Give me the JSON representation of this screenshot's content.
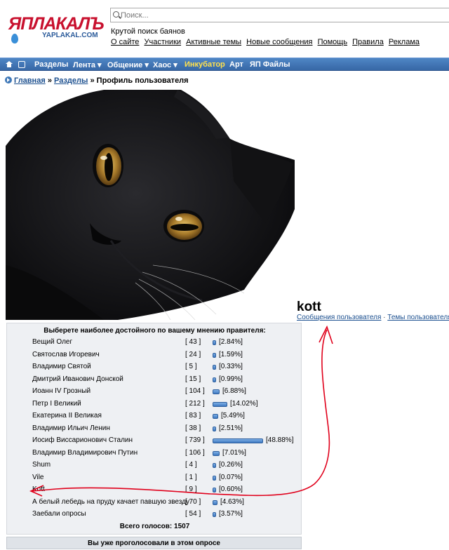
{
  "header": {
    "logo_text": "ЯПЛАКАЛЪ",
    "logo_sub": "YAPLAKAL.COM",
    "search_placeholder": "Поиск...",
    "tagline": "Крутой поиск баянов",
    "links": [
      "О сайте",
      "Участники",
      "Активные темы",
      "Новые сообщения",
      "Помощь",
      "Правила",
      "Реклама"
    ]
  },
  "nav": {
    "items": [
      "Разделы",
      "Лента ▾",
      "Общение ▾",
      "Хаос ▾",
      "Инкубатор",
      "Арт",
      "ЯП Файлы"
    ]
  },
  "breadcrumb": {
    "home": "Главная",
    "section": "Разделы",
    "sep": "»",
    "current": "Профиль пользователя"
  },
  "profile": {
    "username": "kott",
    "posts_link": "Сообщения пользователя",
    "link_sep": "·",
    "topics_link": "Темы пользователя"
  },
  "poll": {
    "title": "Выберете наиболее достойного по вашему мнению правителя:",
    "options": [
      {
        "name": "Вещий Олег",
        "count": "[ 43 ]",
        "percent": "[2.84%]",
        "value": 2.84
      },
      {
        "name": "Святослав Игоревич",
        "count": "[ 24 ]",
        "percent": "[1.59%]",
        "value": 1.59
      },
      {
        "name": "Владимир Святой",
        "count": "[ 5 ]",
        "percent": "[0.33%]",
        "value": 0.33
      },
      {
        "name": "Дмитрий Иванович Донской",
        "count": "[ 15 ]",
        "percent": "[0.99%]",
        "value": 0.99
      },
      {
        "name": "Иоанн IV Грозный",
        "count": "[ 104 ]",
        "percent": "[6.88%]",
        "value": 6.88
      },
      {
        "name": "Петр I Великий",
        "count": "[ 212 ]",
        "percent": "[14.02%]",
        "value": 14.02
      },
      {
        "name": "Екатерина II Великая",
        "count": "[ 83 ]",
        "percent": "[5.49%]",
        "value": 5.49
      },
      {
        "name": "Владимир Ильич Ленин",
        "count": "[ 38 ]",
        "percent": "[2.51%]",
        "value": 2.51
      },
      {
        "name": "Иосиф Виссарионович Сталин",
        "count": "[ 739 ]",
        "percent": "[48.88%]",
        "value": 48.88
      },
      {
        "name": "Владимир Владимирович Путин",
        "count": "[ 106 ]",
        "percent": "[7.01%]",
        "value": 7.01
      },
      {
        "name": "Shum",
        "count": "[ 4 ]",
        "percent": "[0.26%]",
        "value": 0.26
      },
      {
        "name": "Vile",
        "count": "[ 1 ]",
        "percent": "[0.07%]",
        "value": 0.07
      },
      {
        "name": "Kott",
        "count": "[ 9 ]",
        "percent": "[0.60%]",
        "value": 0.6
      },
      {
        "name": "А белый лебедь на пруду качает павшую звезду",
        "count": "[ 70 ]",
        "percent": "[4.63%]",
        "value": 4.63
      },
      {
        "name": "Заебали опросы",
        "count": "[ 54 ]",
        "percent": "[3.57%]",
        "value": 3.57
      }
    ],
    "total": "Всего голосов: 1507",
    "voted_message": "Вы уже проголосовали в этом опросе"
  },
  "colors": {
    "nav_bg": "#3f72b1",
    "link": "#1b4f8f",
    "poll_bg": "#eef0f3",
    "annotation": "#e0001b"
  }
}
